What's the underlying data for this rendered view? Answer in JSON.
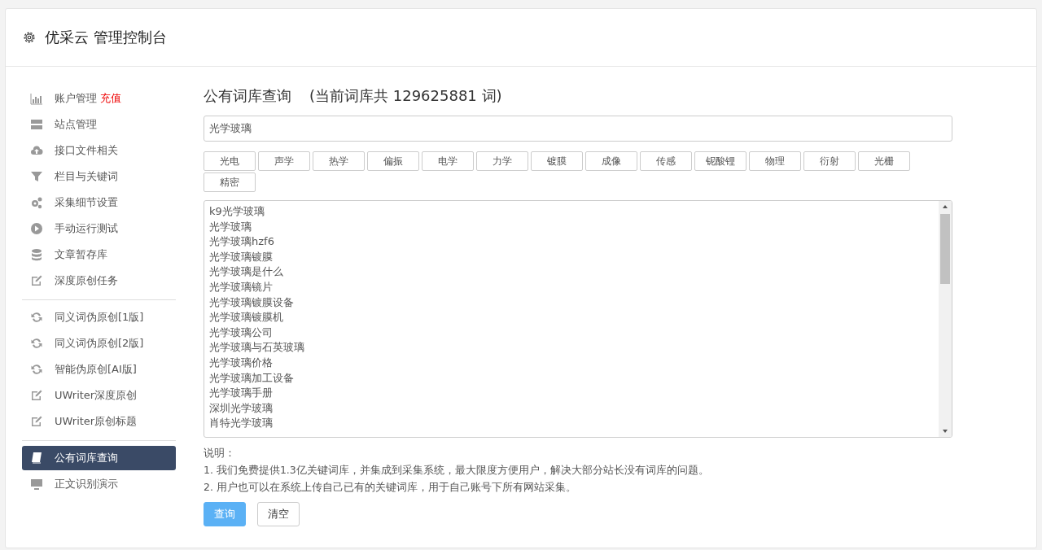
{
  "header": {
    "title": "优采云 管理控制台"
  },
  "sidebar": {
    "groups": [
      {
        "items": [
          {
            "label": "账户管理",
            "link": "充值",
            "selected": false
          },
          {
            "label": "站点管理",
            "selected": false
          },
          {
            "label": "接口文件相关",
            "selected": false
          },
          {
            "label": "栏目与关键词",
            "selected": false
          },
          {
            "label": "采集细节设置",
            "selected": false
          },
          {
            "label": "手动运行测试",
            "selected": false
          },
          {
            "label": "文章暂存库",
            "selected": false
          },
          {
            "label": "深度原创任务",
            "selected": false
          }
        ]
      },
      {
        "items": [
          {
            "label": "同义词伪原创[1版]",
            "selected": false
          },
          {
            "label": "同义词伪原创[2版]",
            "selected": false
          },
          {
            "label": "智能伪原创[AI版]",
            "selected": false
          },
          {
            "label": "UWriter深度原创",
            "selected": false
          },
          {
            "label": "UWriter原创标题",
            "selected": false
          }
        ]
      },
      {
        "items": [
          {
            "label": "公有词库查询",
            "selected": true
          },
          {
            "label": "正文识别演示",
            "selected": false
          }
        ]
      }
    ]
  },
  "main": {
    "title": "公有词库查询",
    "count": "(当前词库共 129625881 词)",
    "search": {
      "value": "光学玻璃"
    },
    "tags": [
      "光电",
      "声学",
      "热学",
      "偏振",
      "电学",
      "力学",
      "镀膜",
      "成像",
      "传感",
      "铌酸锂",
      "物理",
      "衍射",
      "光栅",
      "精密"
    ],
    "results": [
      "k9光学玻璃",
      "光学玻璃",
      "光学玻璃hzf6",
      "光学玻璃镀膜",
      "光学玻璃是什么",
      "光学玻璃镜片",
      "光学玻璃镀膜设备",
      "光学玻璃镀膜机",
      "光学玻璃公司",
      "光学玻璃与石英玻璃",
      "光学玻璃价格",
      "光学玻璃加工设备",
      "光学玻璃手册",
      "深圳光学玻璃",
      "肖特光学玻璃"
    ],
    "notes": [
      "说明：",
      "1. 我们免费提供1.3亿关键词库，并集成到采集系统，最大限度方便用户，解决大部分站长没有词库的问题。",
      "2. 用户也可以在系统上传自己已有的关键词库，用于自己账号下所有网站采集。"
    ],
    "buttons": [
      {
        "label": "查询",
        "kind": "primary"
      },
      {
        "label": "清空",
        "kind": "default"
      }
    ]
  }
}
